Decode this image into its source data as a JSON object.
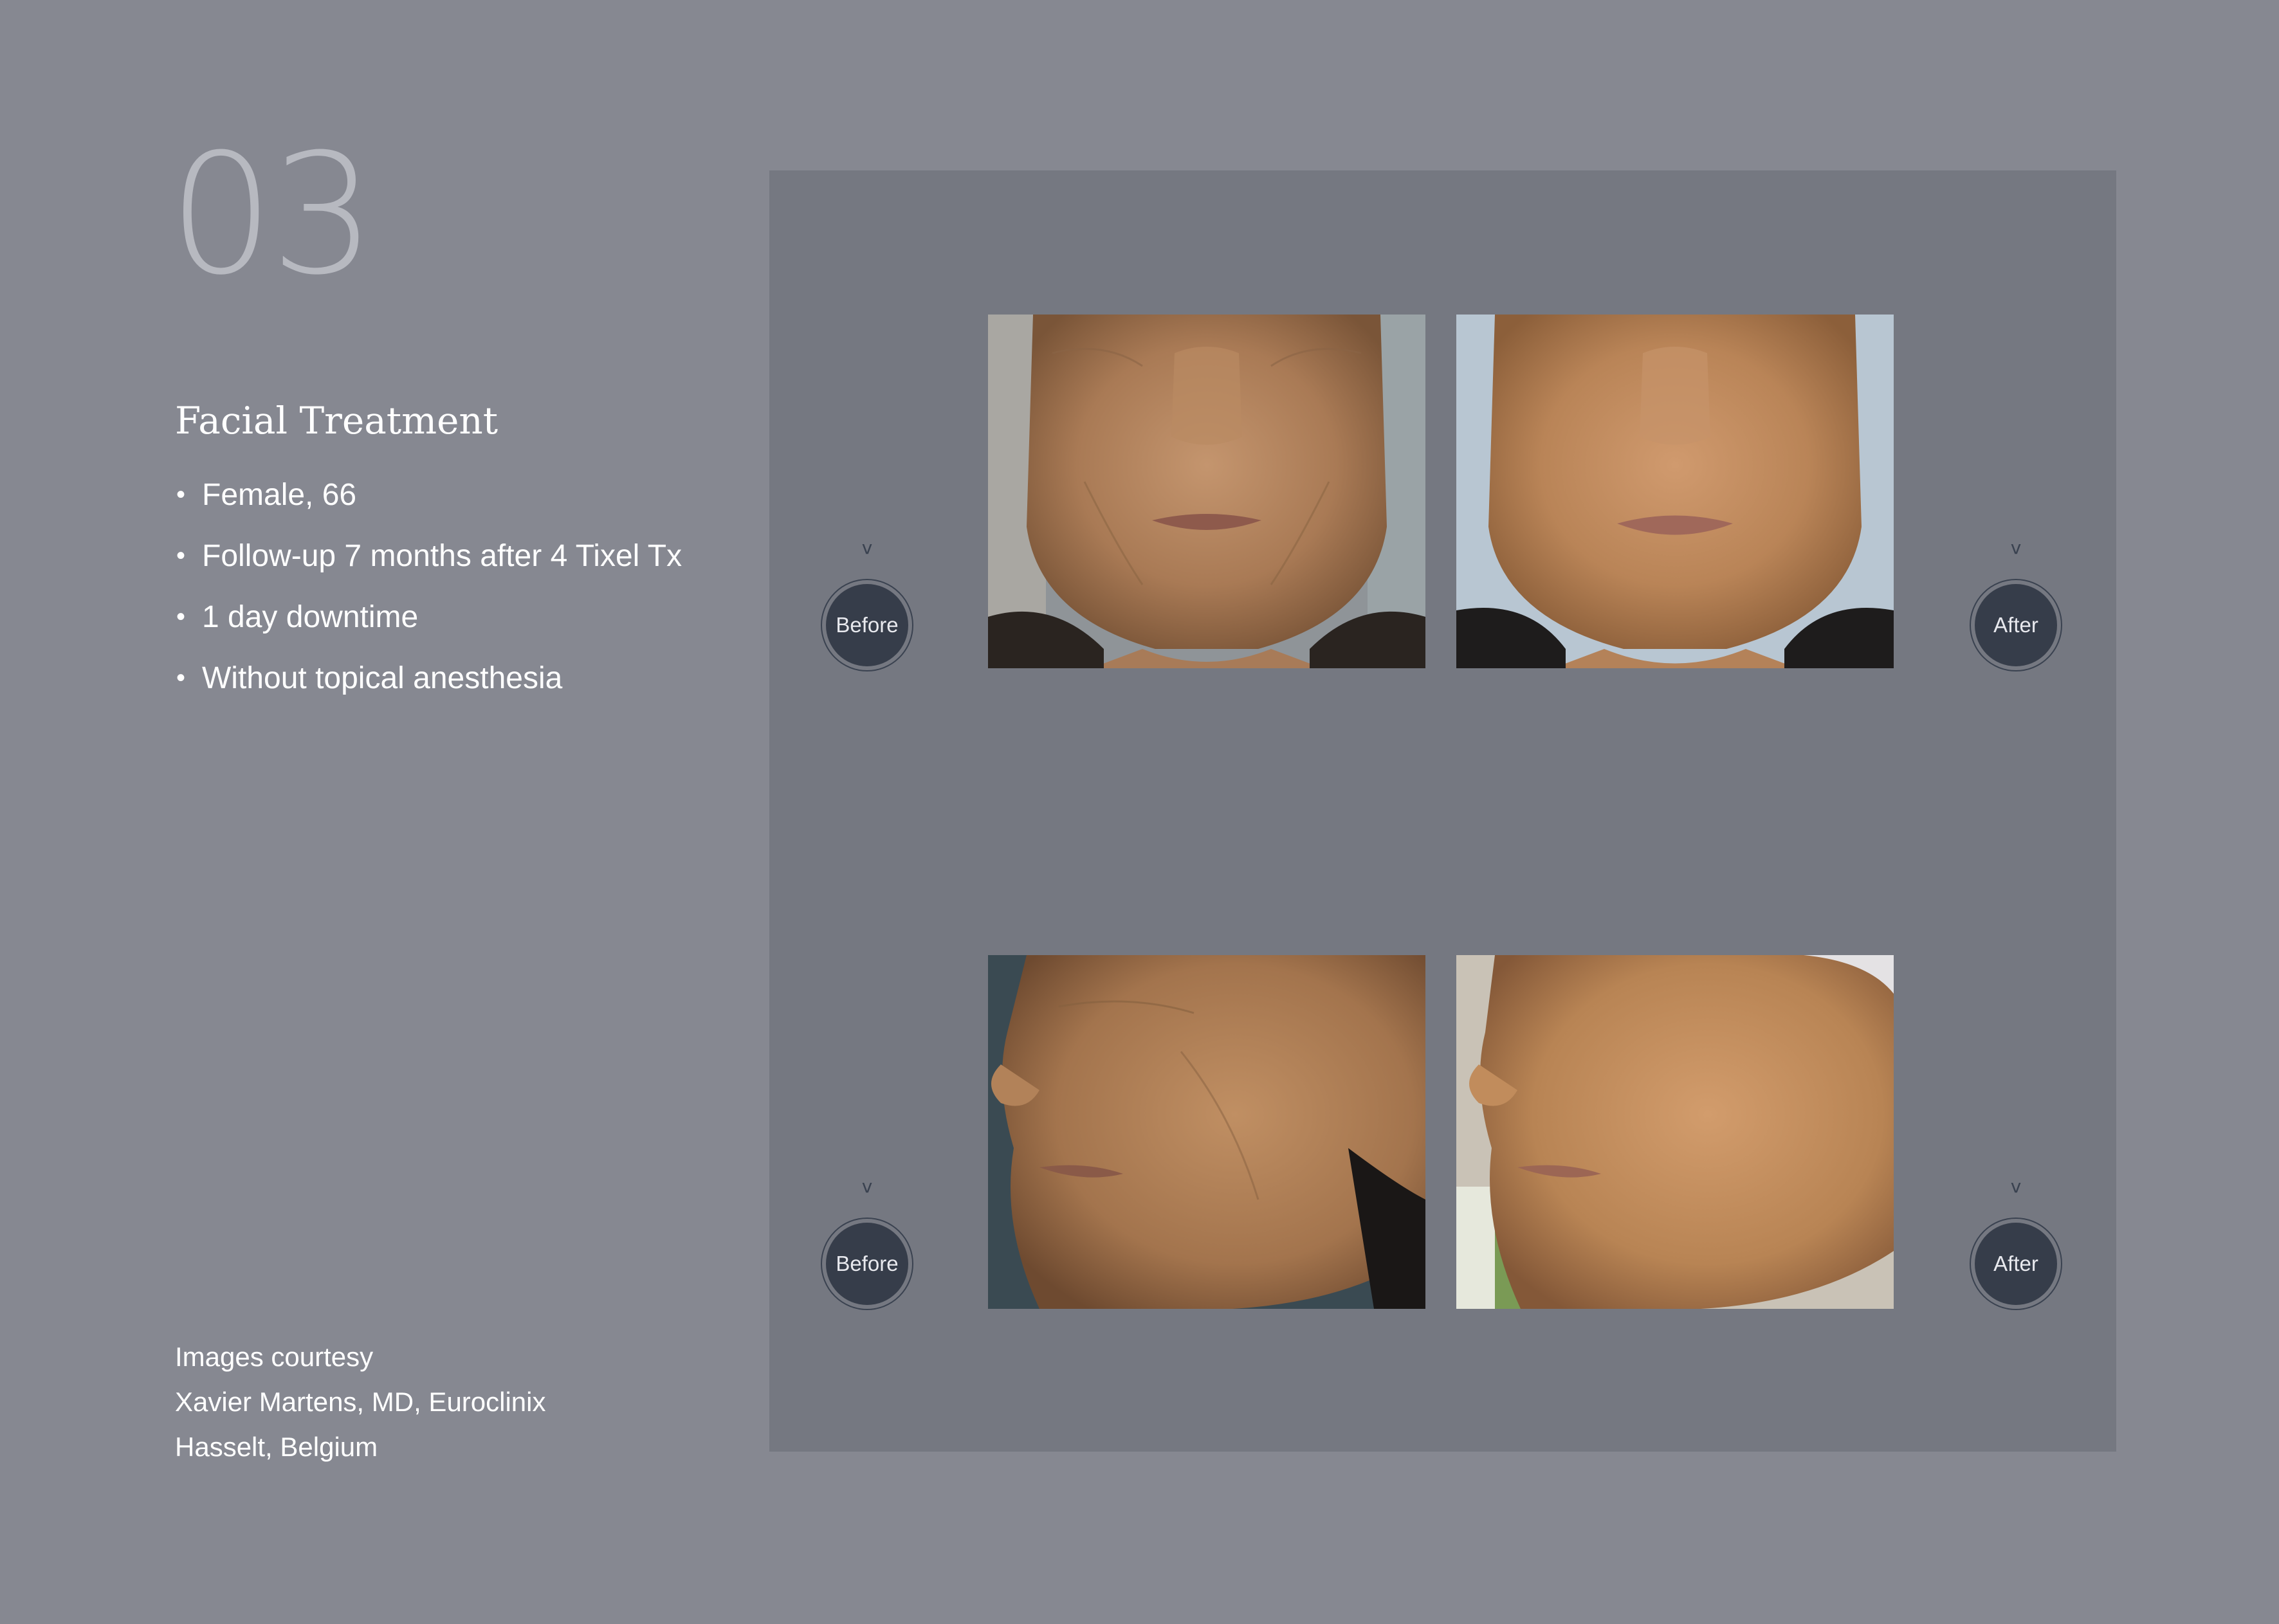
{
  "page_number": "03",
  "title": "Facial Treatment",
  "bullets": [
    "Female, 66",
    "Follow-up 7 months after 4 Tixel Tx",
    "1 day downtime",
    "Without topical anesthesia"
  ],
  "credits": [
    "Images courtesy",
    "Xavier Martens, MD, Euroclinix",
    "Hasselt, Belgium"
  ],
  "labels": {
    "before_top": "Before",
    "after_top": "After",
    "before_bottom": "Before",
    "after_bottom": "After"
  },
  "colors": {
    "background": "#868891",
    "panel": "#757881",
    "badge": "#363d4a",
    "page_number": "#b7b9c0"
  }
}
